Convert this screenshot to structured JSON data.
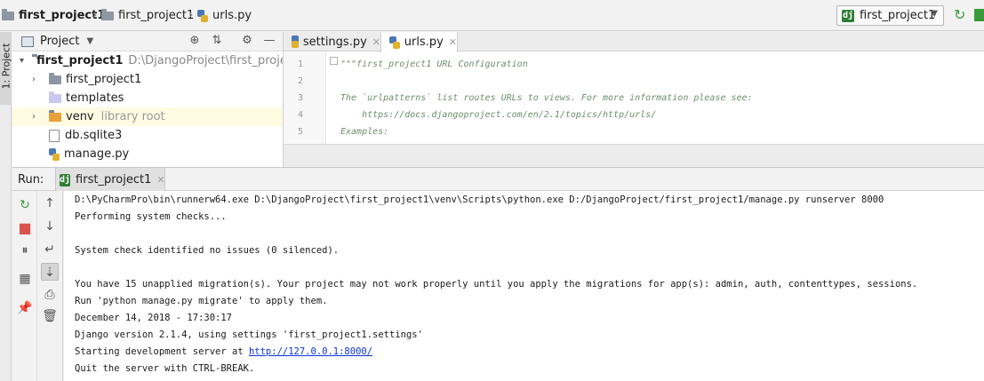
{
  "navbar": {
    "crumbs": [
      "first_project1",
      "first_project1",
      "urls.py"
    ],
    "run_config": "first_project1"
  },
  "left_stripe": {
    "tab": "1: Project"
  },
  "project_panel": {
    "title": "Project",
    "tree": [
      {
        "label": "first_project1",
        "hint": "D:\\DjangoProject\\first_project1"
      },
      {
        "label": "first_project1"
      },
      {
        "label": "templates"
      },
      {
        "label": "venv",
        "hint": "library root"
      },
      {
        "label": "db.sqlite3"
      },
      {
        "label": "manage.py"
      }
    ]
  },
  "editor": {
    "tabs": [
      {
        "label": "settings.py"
      },
      {
        "label": "urls.py"
      }
    ],
    "lines": [
      {
        "num": "1",
        "text": "\"\"\"first_project1 URL Configuration"
      },
      {
        "num": "2",
        "text": ""
      },
      {
        "num": "3",
        "text": "The `urlpatterns` list routes URLs to views. For more information please see:"
      },
      {
        "num": "4",
        "text": "    https://docs.djangoproject.com/en/2.1/topics/http/urls/"
      },
      {
        "num": "5",
        "text": "Examples:"
      }
    ]
  },
  "run": {
    "label": "Run:",
    "tab": "first_project1",
    "console": [
      "D:\\PyCharmPro\\bin\\runnerw64.exe D:\\DjangoProject\\first_project1\\venv\\Scripts\\python.exe D:/DjangoProject/first_project1/manage.py runserver 8000",
      "Performing system checks...",
      "",
      "System check identified no issues (0 silenced).",
      "",
      "You have 15 unapplied migration(s). Your project may not work properly until you apply the migrations for app(s): admin, auth, contenttypes, sessions.",
      "Run 'python manage.py migrate' to apply them.",
      "December 14, 2018 - 17:30:17",
      "Django version 2.1.4, using settings 'first_project1.settings'",
      "Starting development server at ",
      "Quit the server with CTRL-BREAK."
    ],
    "server_link": "http://127.0.0.1:8000/"
  },
  "colors": {
    "link": "#0b34d6",
    "run_green": "#3a9a3a",
    "stop_red": "#d9534f",
    "django_green": "#2e7d32",
    "highlight_row": "#fffbe2"
  }
}
